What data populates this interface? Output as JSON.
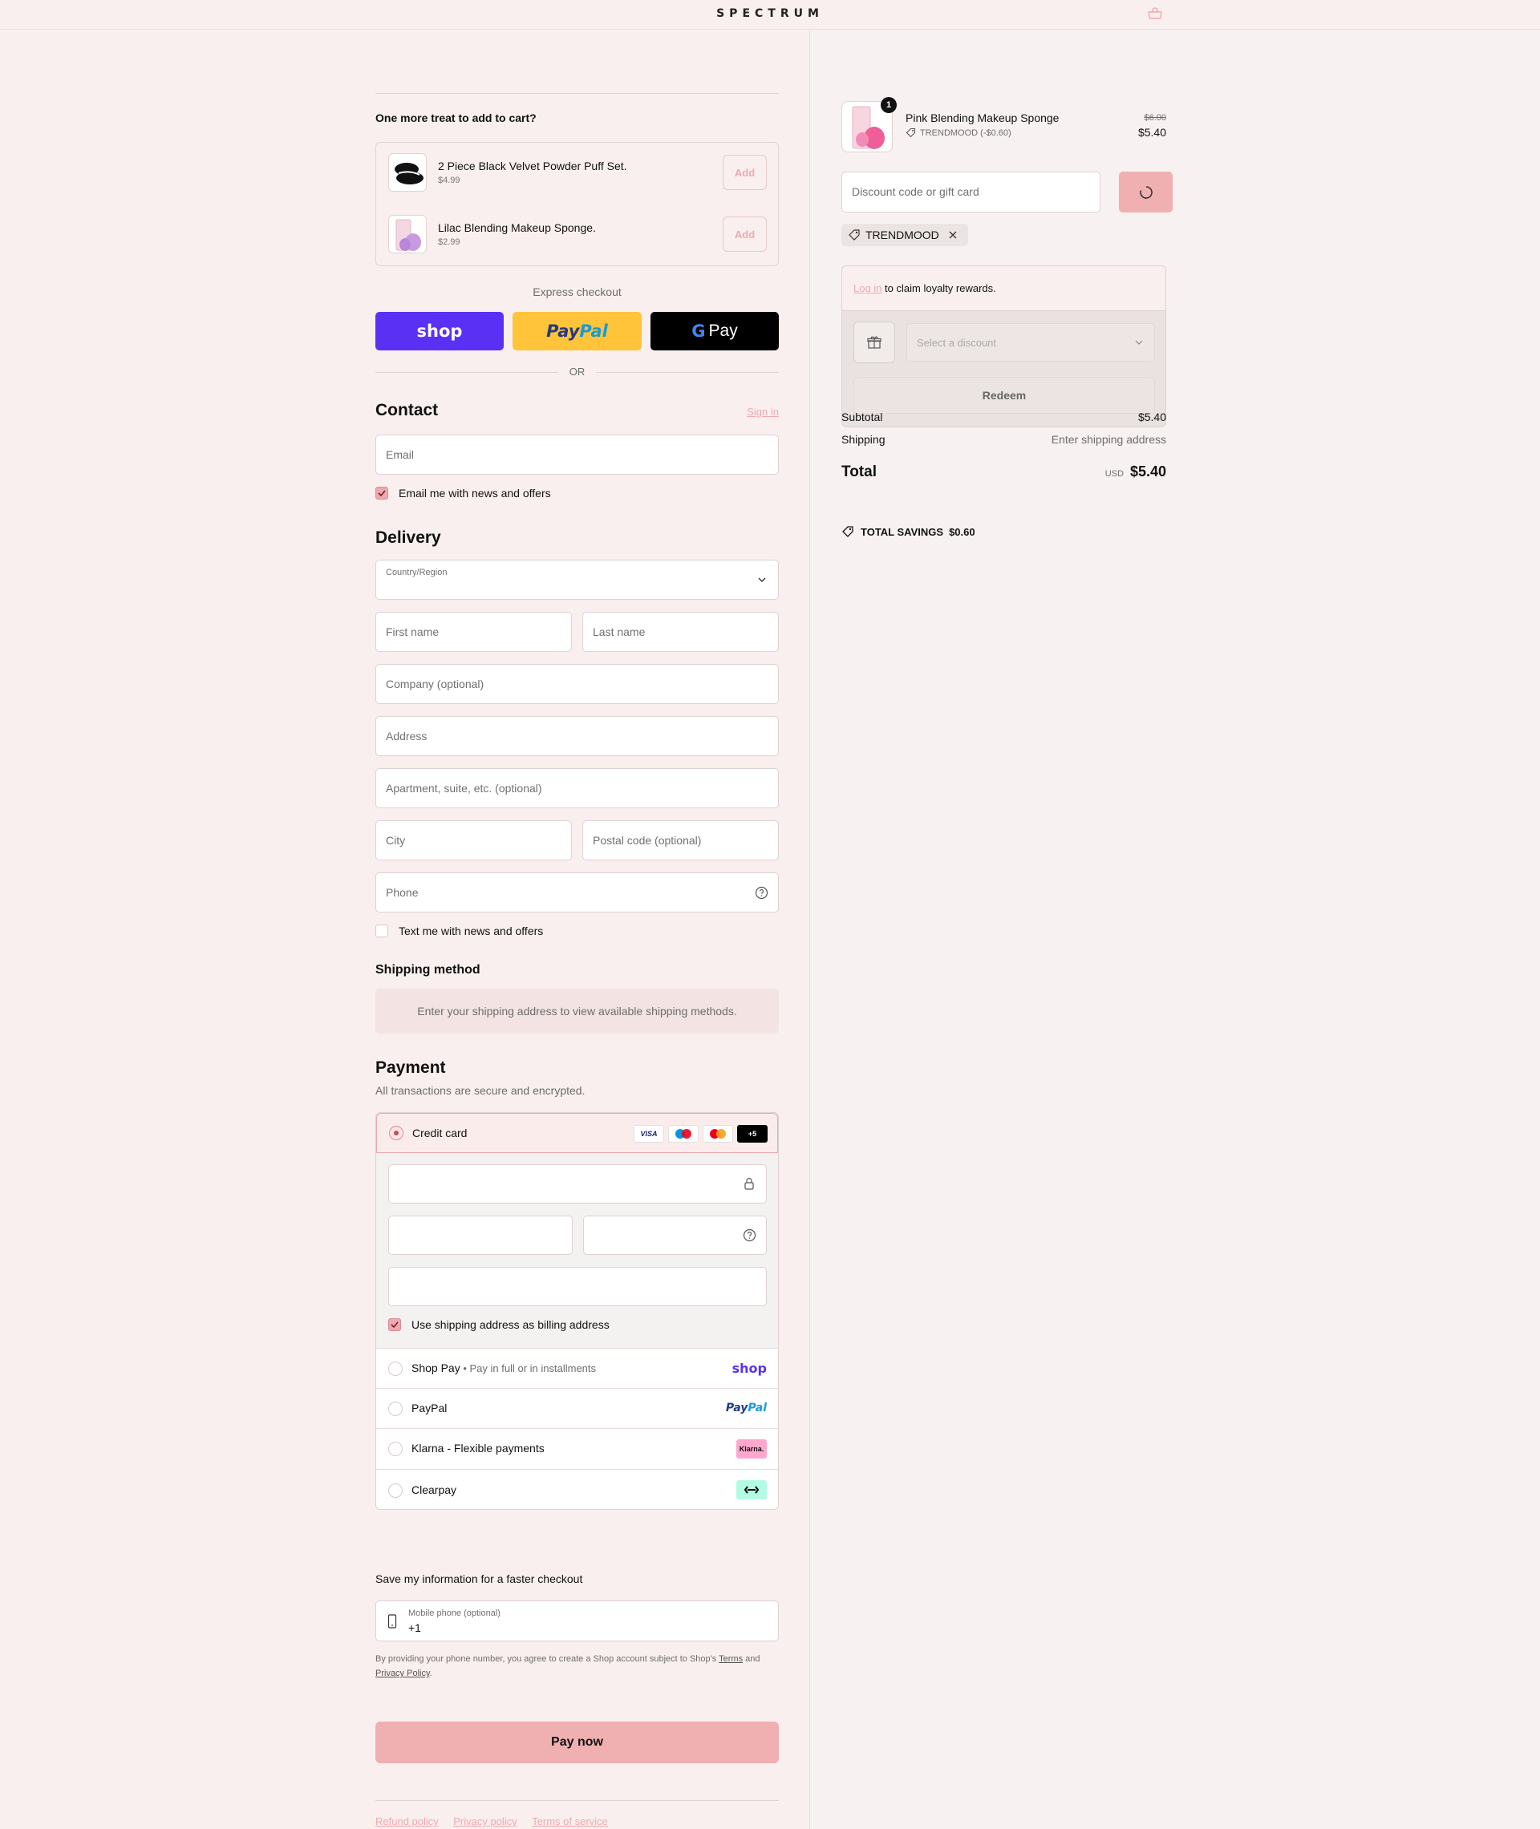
{
  "header": {
    "logo": "SPECTRUM",
    "cart_icon": "shopping-bag-icon"
  },
  "upsell": {
    "title": "One more treat to add to cart?",
    "items": [
      {
        "name": "2 Piece Black Velvet Powder Puff Set.",
        "price": "$4.99",
        "button": "Add"
      },
      {
        "name": "Lilac Blending Makeup Sponge.",
        "price": "$2.99",
        "button": "Add"
      }
    ]
  },
  "express": {
    "label": "Express checkout",
    "shop": "shop",
    "paypal_a": "Pay",
    "paypal_b": "Pal",
    "gpay": "Pay",
    "or": "OR"
  },
  "contact": {
    "title": "Contact",
    "sign_in": "Sign in",
    "email_placeholder": "Email",
    "news_label": "Email me with news and offers"
  },
  "delivery": {
    "title": "Delivery",
    "country_label": "Country/Region",
    "first_name": "First name",
    "last_name": "Last name",
    "company": "Company (optional)",
    "address": "Address",
    "apartment": "Apartment, suite, etc. (optional)",
    "city": "City",
    "postal": "Postal code (optional)",
    "phone": "Phone",
    "text_label": "Text me with news and offers"
  },
  "shipping": {
    "title": "Shipping method",
    "notice": "Enter your shipping address to view available shipping methods."
  },
  "payment": {
    "title": "Payment",
    "subtitle": "All transactions are secure and encrypted.",
    "credit_card": "Credit card",
    "card_brands": [
      "VISA",
      "+5"
    ],
    "billing_label": "Use shipping address as billing address",
    "shop_pay": "Shop Pay",
    "shop_pay_sub": "Pay in full or in installments",
    "shop_logo": "shop",
    "paypal": "PayPal",
    "paypal_logo_a": "Pay",
    "paypal_logo_b": "Pal",
    "klarna": "Klarna - Flexible payments",
    "klarna_logo": "Klarna.",
    "clearpay": "Clearpay"
  },
  "save_info": {
    "title": "Save my information for a faster checkout",
    "phone_label": "Mobile phone (optional)",
    "phone_prefix": "+1",
    "disclaimer_a": "By providing your phone number, you agree to create a Shop account subject to Shop's",
    "terms": "Terms",
    "and": "and",
    "privacy": "Privacy Policy",
    "period": "."
  },
  "pay_now": "Pay now",
  "footer": {
    "links": [
      "Refund policy",
      "Privacy policy",
      "Terms of service"
    ]
  },
  "order": {
    "item_name": "Pink Blending Makeup Sponge",
    "discount_tag": "TRENDMOOD (-$0.60)",
    "old_price": "$6.00",
    "price": "$5.40",
    "quantity": "1",
    "discount_placeholder": "Discount code or gift card",
    "applied_code": "TRENDMOOD",
    "loyalty_login": "Log in",
    "loyalty_text": "to claim loyalty rewards.",
    "select_discount": "Select a discount",
    "redeem": "Redeem",
    "subtotal_label": "Subtotal",
    "subtotal": "$5.40",
    "shipping_label": "Shipping",
    "shipping_value": "Enter shipping address",
    "total_label": "Total",
    "currency": "USD",
    "total": "$5.40",
    "savings_label": "TOTAL SAVINGS",
    "savings": "$0.60"
  },
  "colors": {
    "accent": "#f0a8b0",
    "shop": "#5a31f4",
    "paypal": "#ffc439",
    "background": "#f9efee"
  }
}
